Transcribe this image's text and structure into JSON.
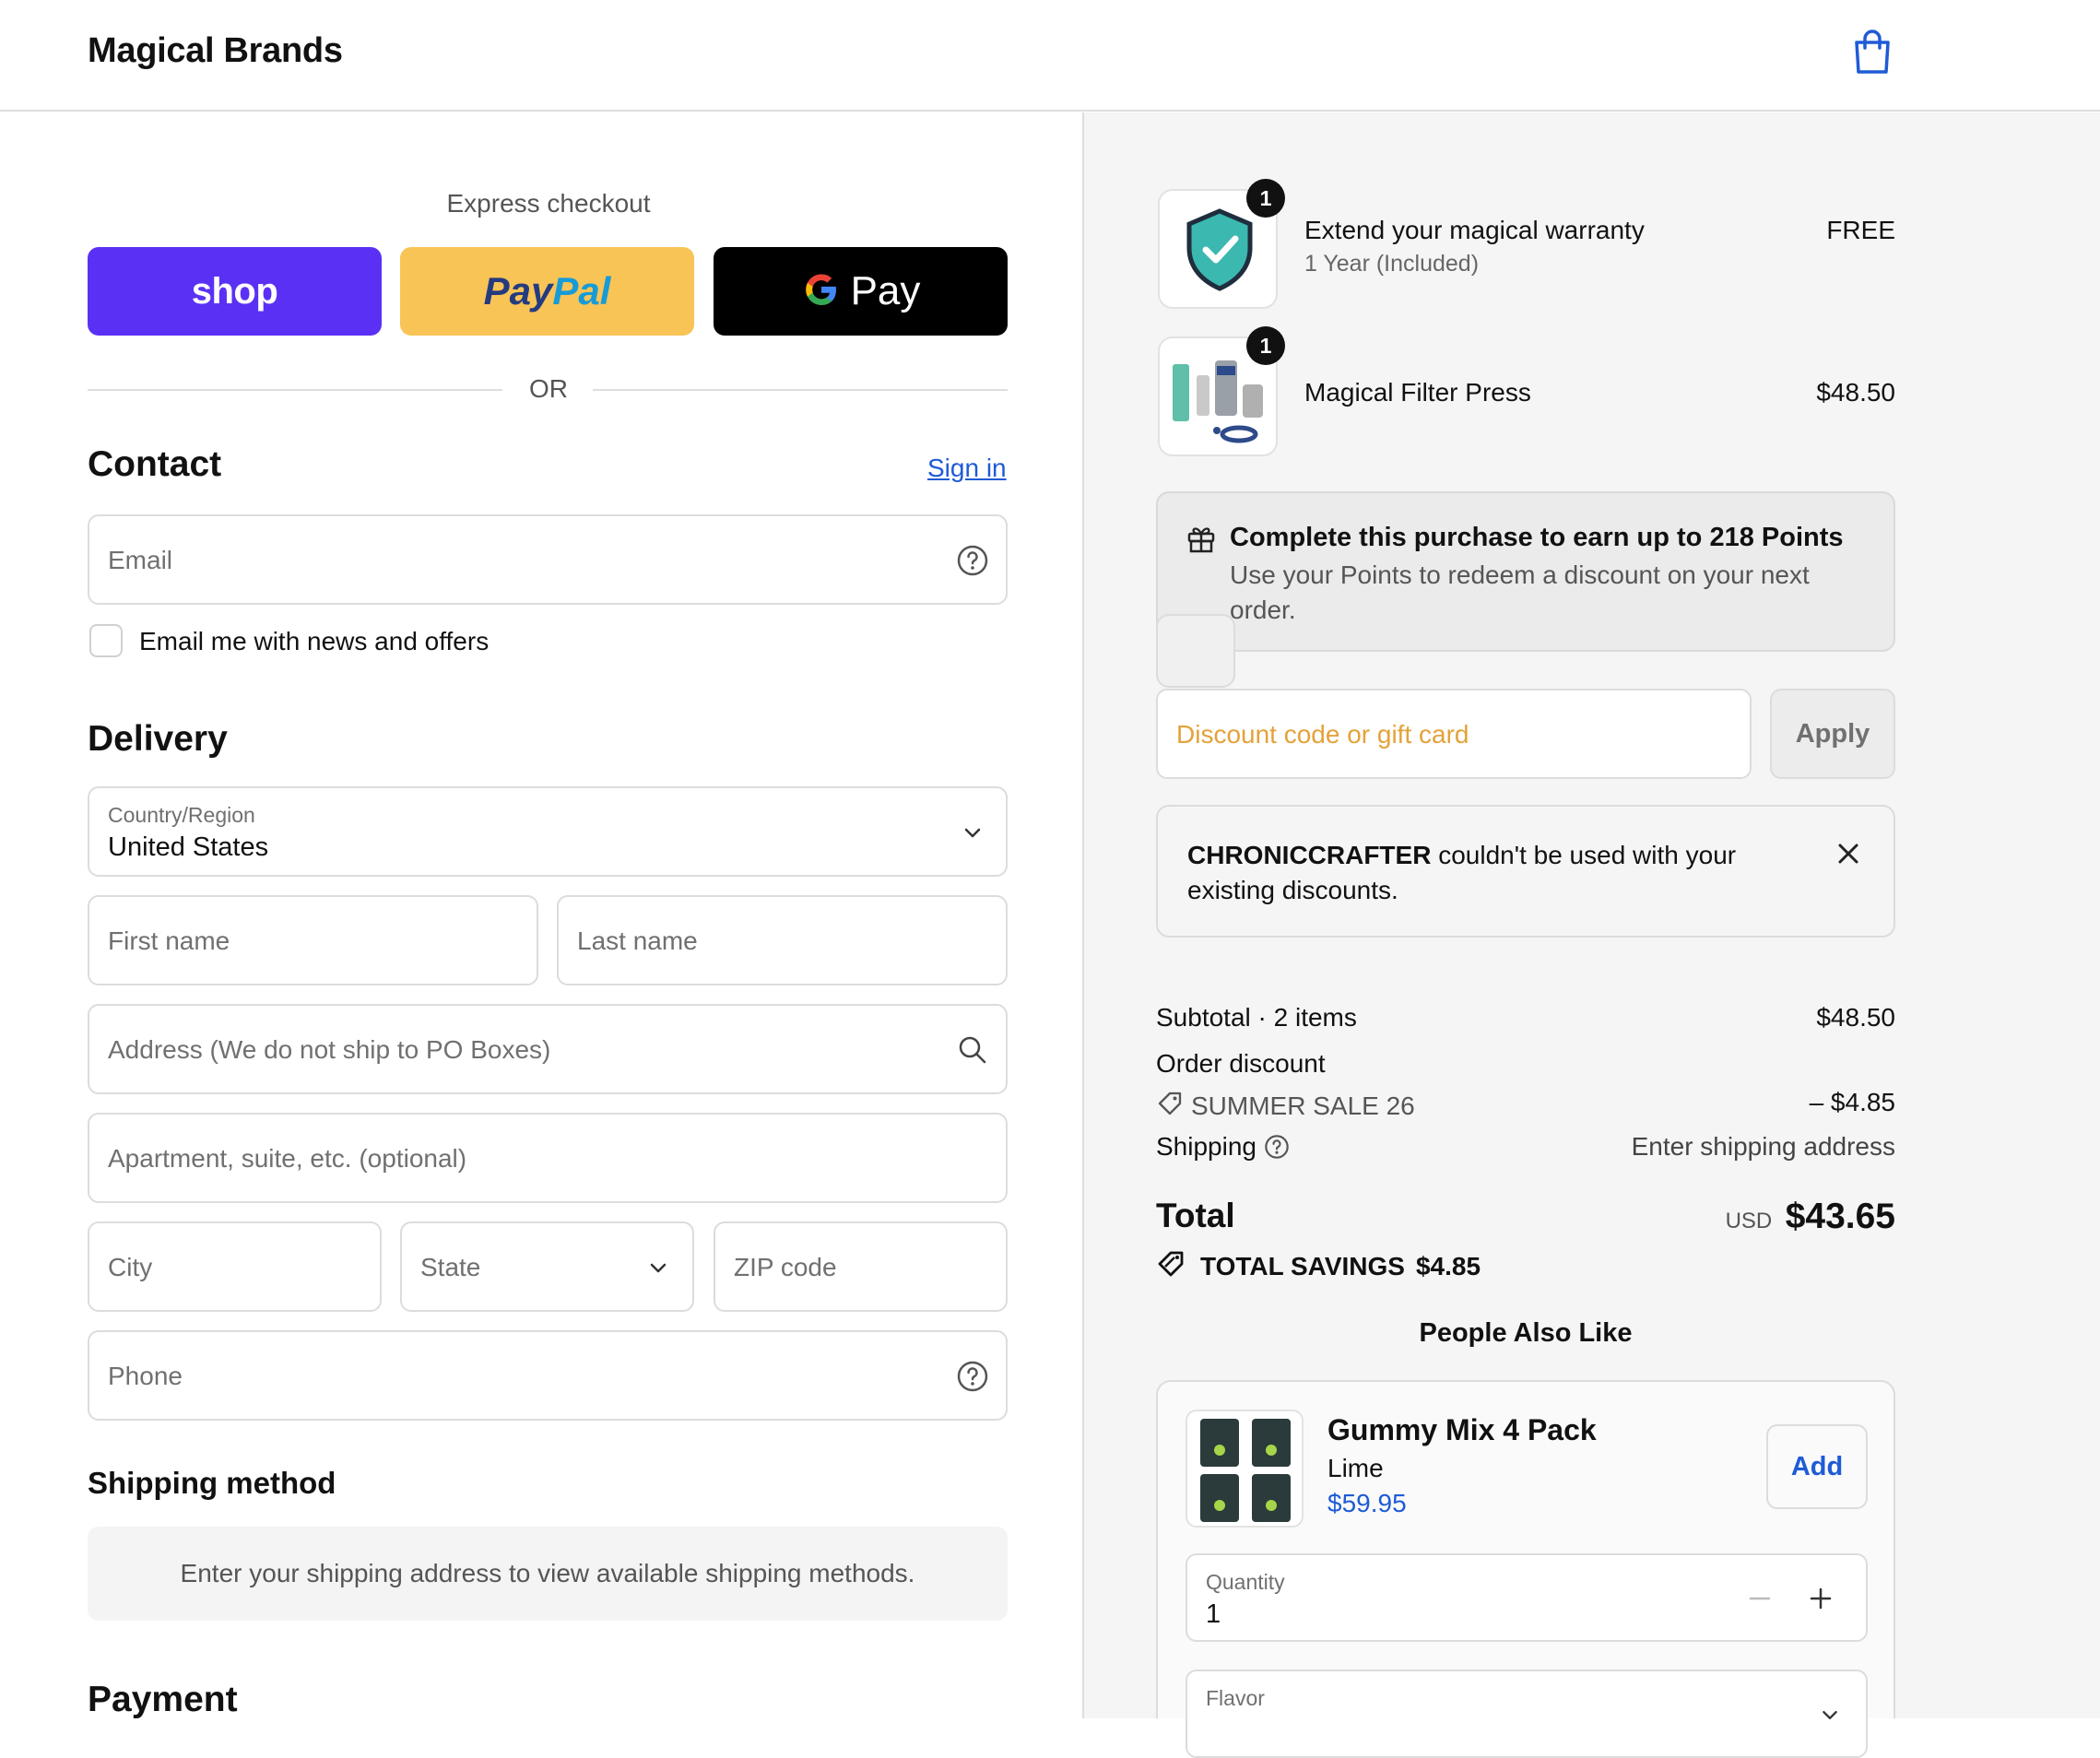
{
  "header": {
    "brand": "Magical Brands",
    "cart_icon": "shopping-bag-icon"
  },
  "express": {
    "label": "Express checkout",
    "shop_label": "shop",
    "paypal_part1": "Pay",
    "paypal_part2": "Pal",
    "gpay_label": "Pay",
    "or_label": "OR"
  },
  "contact": {
    "title": "Contact",
    "sign_in": "Sign in",
    "email_placeholder": "Email",
    "newsletter_label": "Email me with news and offers"
  },
  "delivery": {
    "title": "Delivery",
    "country_label": "Country/Region",
    "country_value": "United States",
    "first_name_placeholder": "First name",
    "last_name_placeholder": "Last name",
    "address_placeholder": "Address (We do not ship to PO Boxes)",
    "apartment_placeholder": "Apartment, suite, etc. (optional)",
    "city_placeholder": "City",
    "state_placeholder": "State",
    "zip_placeholder": "ZIP code",
    "phone_placeholder": "Phone"
  },
  "shipping_method": {
    "title": "Shipping method",
    "notice": "Enter your shipping address to view available shipping methods."
  },
  "payment": {
    "title": "Payment"
  },
  "cart": {
    "items": [
      {
        "quantity": "1",
        "name": "Extend your magical warranty",
        "variant": "1 Year (Included)",
        "price": "FREE"
      },
      {
        "quantity": "1",
        "name": "Magical Filter Press",
        "variant": "",
        "price": "$48.50"
      }
    ]
  },
  "points": {
    "title": "Complete this purchase to earn up to 218 Points",
    "description": "Use your Points to redeem a discount on your next order."
  },
  "discount": {
    "placeholder": "Discount code or gift card",
    "apply_label": "Apply",
    "error_code": "CHRONICCRAFTER",
    "error_message": " couldn't be used with your existing discounts."
  },
  "summary": {
    "subtotal_label": "Subtotal · 2 items",
    "subtotal_value": "$48.50",
    "order_discount_label": "Order discount",
    "discount_code": "SUMMER SALE 26",
    "discount_value": "– $4.85",
    "shipping_label": "Shipping",
    "shipping_value": "Enter shipping address",
    "total_label": "Total",
    "currency": "USD",
    "total_value": "$43.65",
    "savings_label": "TOTAL SAVINGS",
    "savings_value": "$4.85"
  },
  "upsell": {
    "title": "People Also Like",
    "product_name": "Gummy Mix 4 Pack",
    "product_variant": "Lime",
    "product_price": "$59.95",
    "add_label": "Add",
    "quantity_label": "Quantity",
    "quantity_value": "1",
    "flavor_label": "Flavor"
  },
  "colors": {
    "shop_purple": "#5a31f4",
    "paypal_yellow": "#f8c456",
    "link_blue": "#1e5bd6",
    "discount_placeholder": "#e4a23a"
  }
}
